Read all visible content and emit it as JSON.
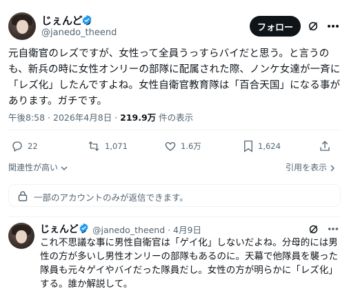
{
  "tweet": {
    "author_name": "じぇんどぅ",
    "handle": "@janedo_theend",
    "follow_label": "フォロー",
    "text": "元自衛官のレズですが、女性って全員うっすらバイだと思う。と言うのも、新兵の時に女性オンリーの部隊に配属された際、ノンケ女達が一斉に「レズ化」したんですよね。女性自衛官教育隊は「百合天国」になる事があります。ガチです。",
    "time": "午後8:58 · 2026年4月8日 · ",
    "views_count": "219.9万",
    "views_label": " 件の表示"
  },
  "actions": {
    "reply_count": "22",
    "retweet_count": "1,071",
    "like_count": "1.6万",
    "bookmark_count": "1,624"
  },
  "sort": {
    "relevance": "関連性が高い",
    "quote_label": "引用を表示"
  },
  "notice": {
    "text": "一部のアカウントのみが返信できます。"
  },
  "reply": {
    "author_name": "じぇんどぅ",
    "handle_date": "@janedo_theend · 4月9日",
    "text": "これ不思議な事に男性自衛官は「ゲイ化」しないだよね。分母的には男性の方が多いし男性オンリーの部隊もあるのに。天幕で他隊員を襲った隊員も元々ゲイやバイだった隊員だし。女性の方が明らかに「レズ化」する。誰か解説して。"
  },
  "colors": {
    "verified": "#1d9bf0",
    "text": "#0f1419",
    "muted": "#536471",
    "divider": "#eff3f4"
  },
  "icons": [
    "verified-badge-icon",
    "grok-icon",
    "more-icon",
    "reply-icon",
    "retweet-icon",
    "like-icon",
    "bookmark-icon",
    "share-icon",
    "chevron-down-icon",
    "chevron-right-icon",
    "lock-icon"
  ]
}
